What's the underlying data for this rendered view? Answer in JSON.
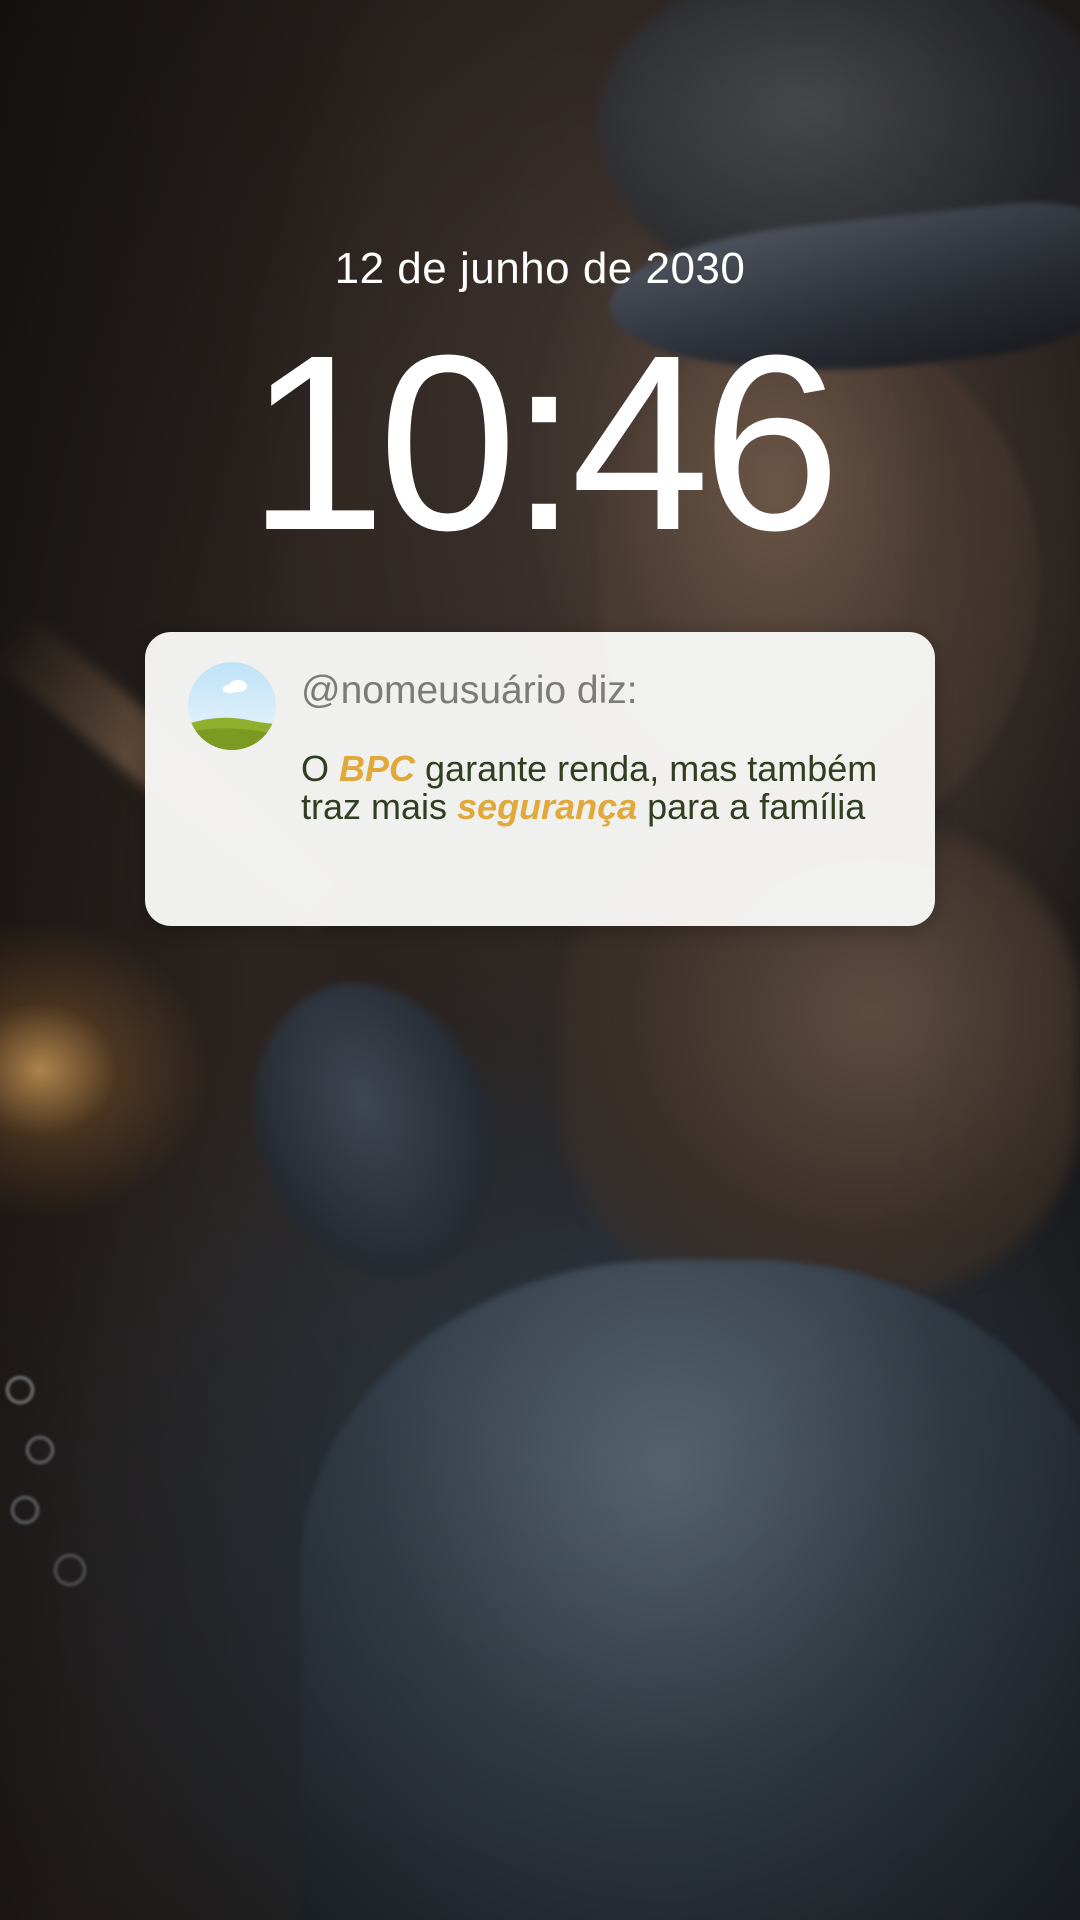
{
  "lock_screen": {
    "date": "12 de junho de 2030",
    "time": "10:46"
  },
  "notification": {
    "sender": "@nomeusuário diz:",
    "avatar_icon": "landscape-avatar-icon",
    "message_parts": {
      "p1": "O ",
      "p2": "BPC",
      "p3": " garante renda, mas também traz mais ",
      "p4": "segurança",
      "p5": " para a família"
    }
  },
  "colors": {
    "highlight": "#e0a93a",
    "message_text": "#2f3f1f",
    "sender_text": "#7b7b7b",
    "card_background": "#f7f7f6"
  }
}
